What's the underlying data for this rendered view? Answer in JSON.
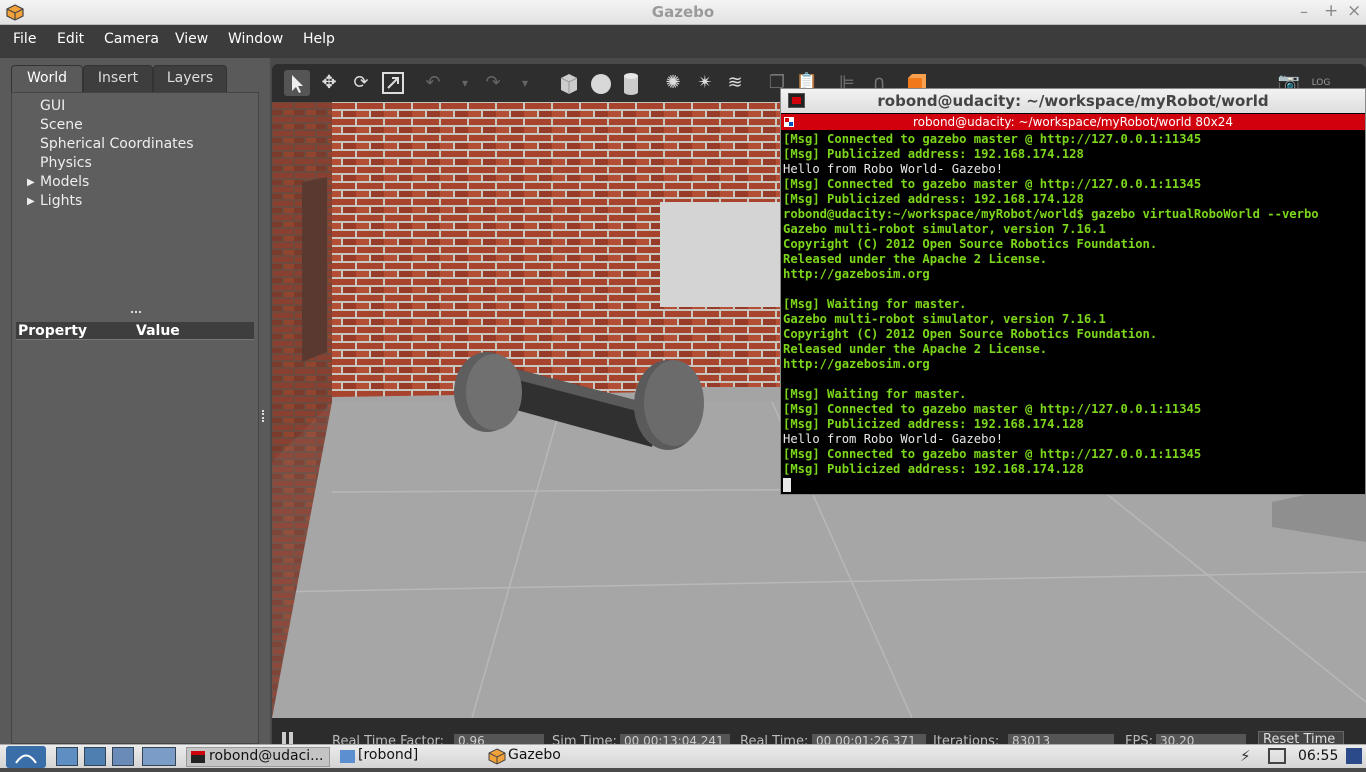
{
  "window": {
    "title": "Gazebo",
    "controls": [
      "–",
      "+",
      "×"
    ]
  },
  "menubar": [
    "File",
    "Edit",
    "Camera",
    "View",
    "Window",
    "Help"
  ],
  "left_panel": {
    "tabs": [
      "World",
      "Insert",
      "Layers"
    ],
    "tree": [
      "GUI",
      "Scene",
      "Spherical Coordinates",
      "Physics",
      "Models",
      "Lights"
    ],
    "property_header": "Property",
    "value_header": "Value"
  },
  "terminal": {
    "title": "robond@udacity: ~/workspace/myRobot/world",
    "subtitle": "robond@udacity: ~/workspace/myRobot/world 80x24",
    "lines": [
      "[Msg] Connected to gazebo master @ http://127.0.0.1:11345",
      "[Msg] Publicized address: 192.168.174.128",
      "Hello from Robo World- Gazebo!",
      "[Msg] Connected to gazebo master @ http://127.0.0.1:11345",
      "[Msg] Publicized address: 192.168.174.128",
      "robond@udacity:~/workspace/myRobot/world$ gazebo virtualRoboWorld --verbo",
      "Gazebo multi-robot simulator, version 7.16.1",
      "Copyright (C) 2012 Open Source Robotics Foundation.",
      "Released under the Apache 2 License.",
      "http://gazebosim.org",
      "",
      "[Msg] Waiting for master.",
      "Gazebo multi-robot simulator, version 7.16.1",
      "Copyright (C) 2012 Open Source Robotics Foundation.",
      "Released under the Apache 2 License.",
      "http://gazebosim.org",
      "",
      "[Msg] Waiting for master.",
      "[Msg] Connected to gazebo master @ http://127.0.0.1:11345",
      "[Msg] Publicized address: 192.168.174.128",
      "Hello from Robo World- Gazebo!",
      "[Msg] Connected to gazebo master @ http://127.0.0.1:11345",
      "[Msg] Publicized address: 192.168.174.128"
    ]
  },
  "status": {
    "rtf_label": "Real Time Factor:",
    "rtf": "0.96",
    "sim_label": "Sim Time:",
    "sim": "00 00:13:04.241",
    "real_label": "Real Time:",
    "real": "00 00:01:26.371",
    "iter_label": "Iterations:",
    "iter": "83013",
    "fps_label": "FPS:",
    "fps": "30.20",
    "reset_label": "Reset Time"
  },
  "taskbar": {
    "terminal_task": "robond@udaci...",
    "folder_task": "[robond]",
    "gazebo_task": "Gazebo",
    "clock": "06:55"
  },
  "colors": {
    "terminal_green": "#7cd61b",
    "terminal_red_bar": "#d0000c",
    "brick": "#a8432e"
  }
}
